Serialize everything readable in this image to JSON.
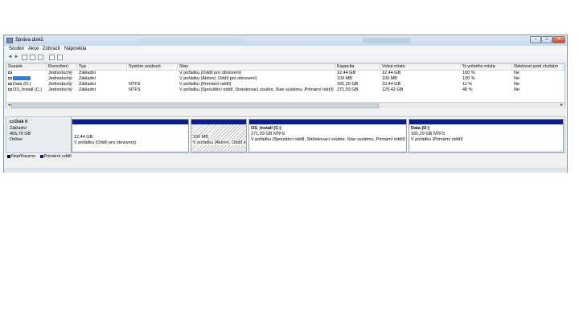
{
  "window": {
    "title": "Správa disků"
  },
  "menu": [
    "Soubor",
    "Akce",
    "Zobrazit",
    "Nápověda"
  ],
  "window_buttons": {
    "minimize": "–",
    "maximize": "□",
    "close": "×"
  },
  "volume_table": {
    "columns": [
      "Svazek",
      "Rozvržení",
      "Typ",
      "Systém souborů",
      "Stav",
      "Kapacita",
      "Volné místo",
      "% volného místa",
      "Odolnost proti chybám"
    ],
    "rows": [
      [
        "",
        "Jednoduchý",
        "Základní",
        "",
        "V pořádku (Oddíl pro obnovení)",
        "12,44 GB",
        "12,44 GB",
        "100 %",
        "Ne"
      ],
      [
        "",
        "Jednoduchý",
        "Základní",
        "",
        "V pořádku (Aktivní, Oddíl pro obnovení)",
        "100 MB",
        "100 MB",
        "100 %",
        "Ne"
      ],
      [
        "Data (D:)",
        "Jednoduchý",
        "Základní",
        "NTFS",
        "V pořádku (Primární oddíl)",
        "181,29 GB",
        "19,44 GB",
        "11 %",
        "Ne"
      ],
      [
        "OS_Install (C:)",
        "Jednoduchý",
        "Základní",
        "NTFS",
        "V pořádku (Spouštěcí oddíl, Stránkovací soubor, Stav systému, Primární oddíl)",
        "271,93 GB",
        "129,42 GB",
        "48 %",
        "Ne"
      ]
    ]
  },
  "disk": {
    "name": "Disk 0",
    "type": "Základní",
    "size": "465,76 GB",
    "status": "Online",
    "partitions": [
      {
        "name": "",
        "size": "12,44 GB",
        "status": "V pořádku (Oddíl pro obnovení)"
      },
      {
        "name": "",
        "size": "100 MB",
        "status": "V pořádku (Aktivní, Oddíl p"
      },
      {
        "name": "OS_Install  (C:)",
        "size": "271,93 GB NTFS",
        "status": "V pořádku (Spouštěcí oddíl, Stránkovací soubor, Stav systému, Primární oddíl)"
      },
      {
        "name": "Data  (D:)",
        "size": "181,29 GB NTFS",
        "status": "V pořádku (Primární oddíl)"
      }
    ]
  },
  "legend": [
    {
      "label": "Nepřiřazeno",
      "color": "#000000"
    },
    {
      "label": "Primární oddíl",
      "color": "#0c1c8c"
    }
  ]
}
